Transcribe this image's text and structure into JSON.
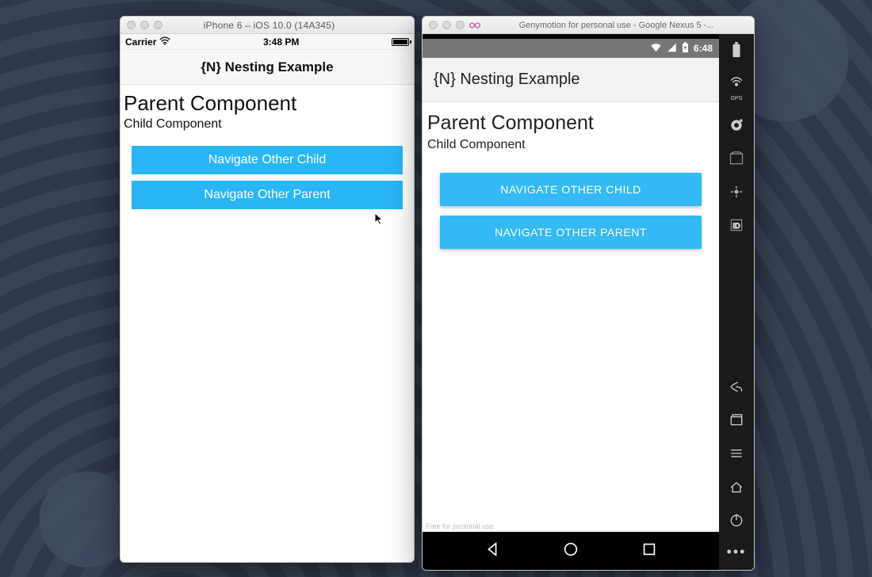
{
  "ios": {
    "window_title": "iPhone 6 – iOS 10.0 (14A345)",
    "carrier": "Carrier",
    "time": "3:48 PM",
    "app_title": "{N} Nesting Example",
    "heading": "Parent Component",
    "subheading": "Child Component",
    "btn_child": "Navigate Other Child",
    "btn_parent": "Navigate Other Parent"
  },
  "android": {
    "window_title": "Genymotion for personal use - Google Nexus 5 -...",
    "time": "6:48",
    "app_title": "{N} Nesting Example",
    "heading": "Parent Component",
    "subheading": "Child Component",
    "btn_child": "NAVIGATE OTHER CHILD",
    "btn_parent": "NAVIGATE OTHER PARENT",
    "watermark": "Free for personal use",
    "gps_label": "GPS"
  },
  "colors": {
    "button": "#29b6f6"
  }
}
